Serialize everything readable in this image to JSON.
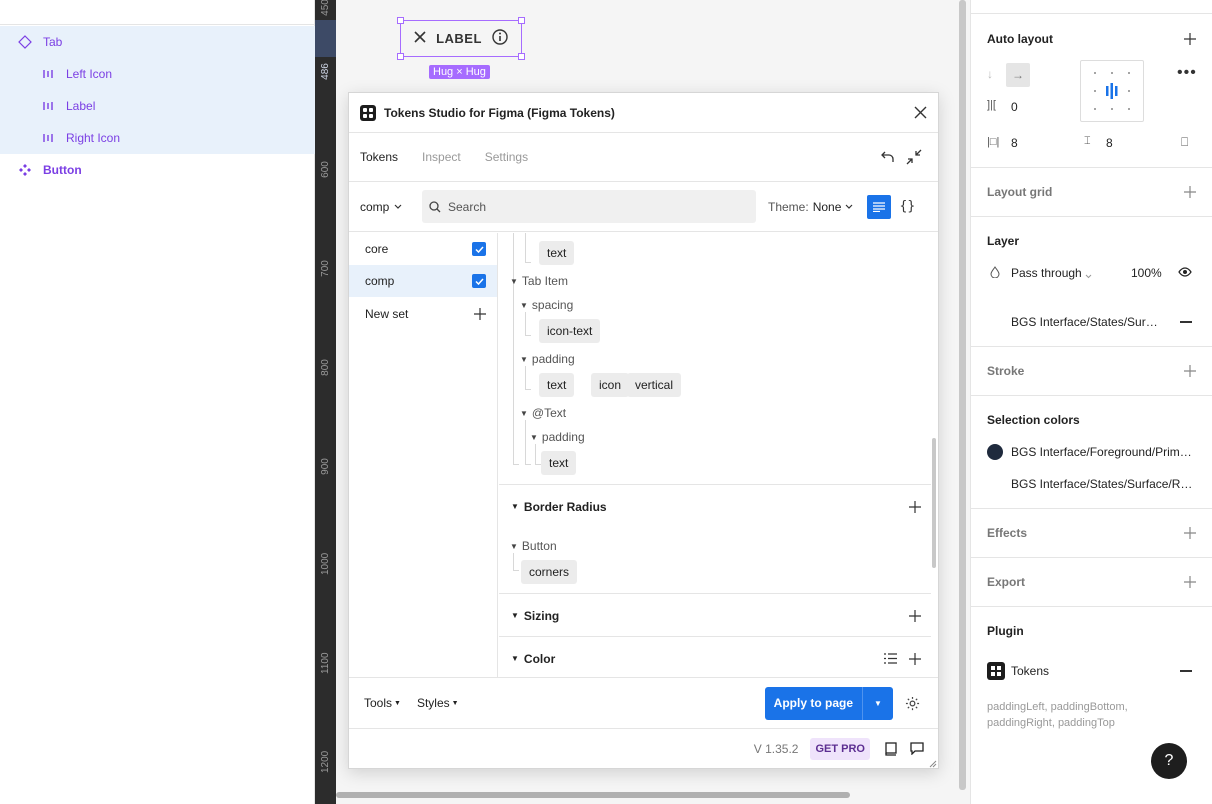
{
  "layers": {
    "items": [
      {
        "label": "Tab",
        "icon": "component-instance-icon"
      },
      {
        "label": "Left Icon",
        "icon": "auto-layout-icon"
      },
      {
        "label": "Label",
        "icon": "auto-layout-icon"
      },
      {
        "label": "Right Icon",
        "icon": "auto-layout-icon"
      },
      {
        "label": "Button",
        "icon": "component-icon"
      }
    ]
  },
  "ruler": {
    "ticks": [
      "450",
      "486",
      "600",
      "700",
      "800",
      "900",
      "1000",
      "1100",
      "1200"
    ]
  },
  "canvas": {
    "component_label": "LABEL",
    "size_badge": "Hug × Hug"
  },
  "plugin": {
    "title": "Tokens Studio for Figma (Figma Tokens)",
    "tabs": [
      "Tokens",
      "Inspect",
      "Settings"
    ],
    "set_selector": "comp",
    "search_placeholder": "Search",
    "theme_label": "Theme:",
    "theme_value": "None",
    "sets": [
      {
        "name": "core",
        "checked": true
      },
      {
        "name": "comp",
        "checked": true
      },
      {
        "name": "New set"
      }
    ],
    "tree": {
      "top_chip": "text",
      "tab_item": "Tab Item",
      "spacing": "spacing",
      "spacing_chips": [
        "icon-text"
      ],
      "padding": "padding",
      "padding_chips": [
        "text",
        "icon",
        "vertical"
      ],
      "text_group": "@Text",
      "text_padding": "padding",
      "text_padding_chips": [
        "text"
      ]
    },
    "sections": {
      "border_radius": "Border Radius",
      "button_group": "Button",
      "button_chips": [
        "corners"
      ],
      "sizing": "Sizing",
      "color": "Color"
    },
    "footer": {
      "tools": "Tools",
      "styles": "Styles",
      "apply": "Apply to page",
      "version": "V 1.35.2",
      "get_pro": "GET PRO"
    }
  },
  "properties": {
    "auto_layout": {
      "title": "Auto layout",
      "spacing": "0",
      "padding_h": "8",
      "padding_v": "8"
    },
    "layout_grid": {
      "title": "Layout grid"
    },
    "layer": {
      "title": "Layer",
      "blend": "Pass through",
      "opacity": "100%",
      "fill_style": "BGS Interface/States/Surface/Rest"
    },
    "stroke": {
      "title": "Stroke"
    },
    "selection_colors": {
      "title": "Selection colors",
      "items": [
        {
          "label": "BGS Interface/Foreground/Primary",
          "color": "#1f2a3d"
        },
        {
          "label": "BGS Interface/States/Surface/Rest"
        }
      ]
    },
    "effects": {
      "title": "Effects"
    },
    "export": {
      "title": "Export"
    },
    "plugin": {
      "title": "Plugin",
      "name": "Tokens",
      "props": "paddingLeft, paddingBottom, paddingRight, paddingTop"
    }
  },
  "colors": {
    "accent": "#1a73e8",
    "component": "#7b3fe4",
    "selection": "#a66cff"
  }
}
